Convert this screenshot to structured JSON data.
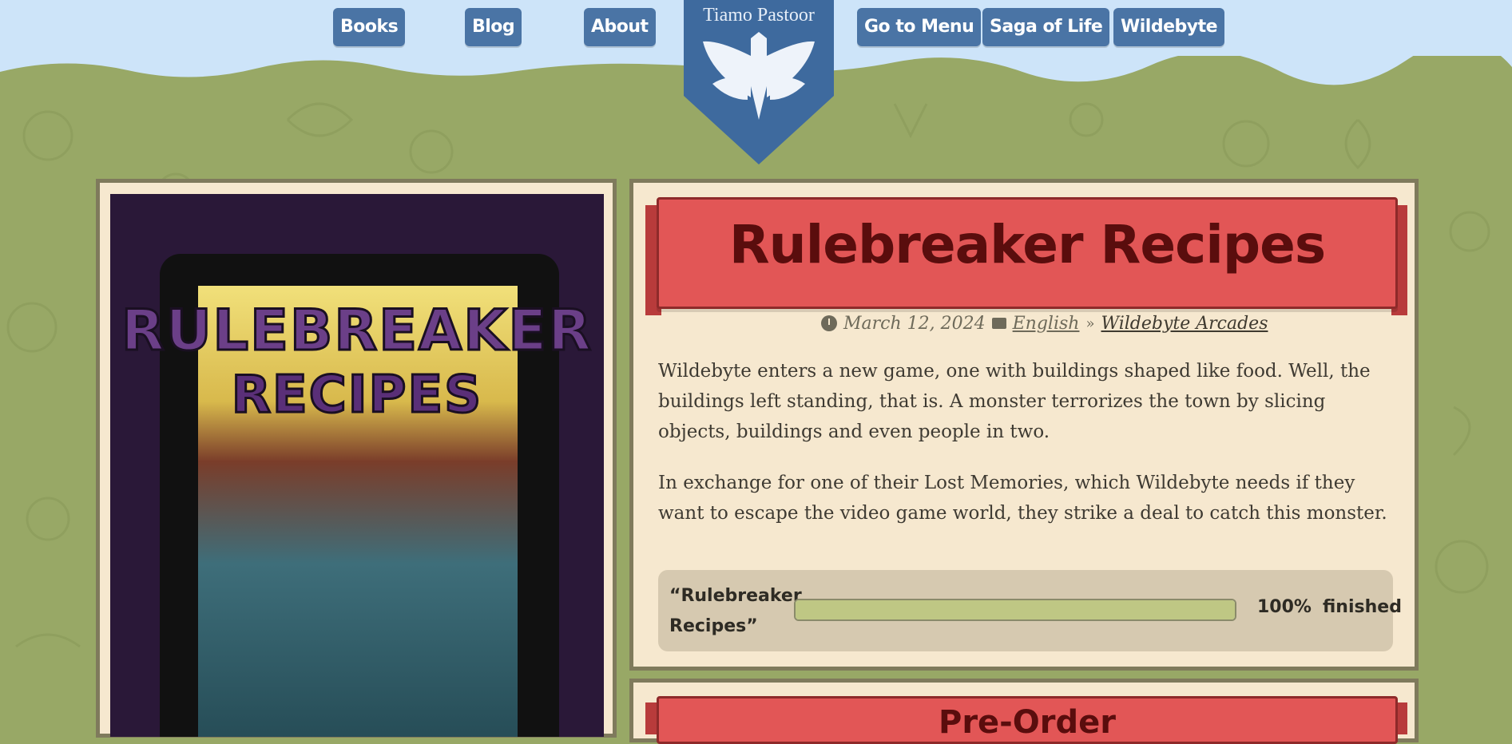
{
  "nav": {
    "books": "Books",
    "blog": "Blog",
    "about": "About",
    "menu": "Go to Menu",
    "saga": "Saga of Life",
    "wildebyte": "Wildebyte"
  },
  "logo": {
    "name": "Tiamo Pastoor",
    "icon": "winged-pen-icon"
  },
  "cover": {
    "title_line1": "RULEBREAKER",
    "title_line2": "RECIPES"
  },
  "book": {
    "title": "Rulebreaker Recipes",
    "date": "March 12, 2024",
    "language": "English",
    "series": "Wildebyte Arcades",
    "paragraph1": "Wildebyte enters a new game, one with buildings shaped like food. Well, the buildings left standing, that is. A monster terrorizes the town by slicing objects, buildings and even people in two.",
    "paragraph2": "In exchange for one of their Lost Memories, which Wildebyte needs if they want to escape the video game world, they strike a deal to catch this monster."
  },
  "progress": {
    "label": "“Rulebreaker Recipes”",
    "percent_text": "100%",
    "status": "finished",
    "fraction": 1.0
  },
  "section2": {
    "title": "Pre-Order"
  },
  "colors": {
    "sky": "#cde4f9",
    "grass": "#98a866",
    "nav": "#4a74a5",
    "banner": "#e25656",
    "panel": "#f6e8cf",
    "progress_fill": "#bfc784"
  }
}
